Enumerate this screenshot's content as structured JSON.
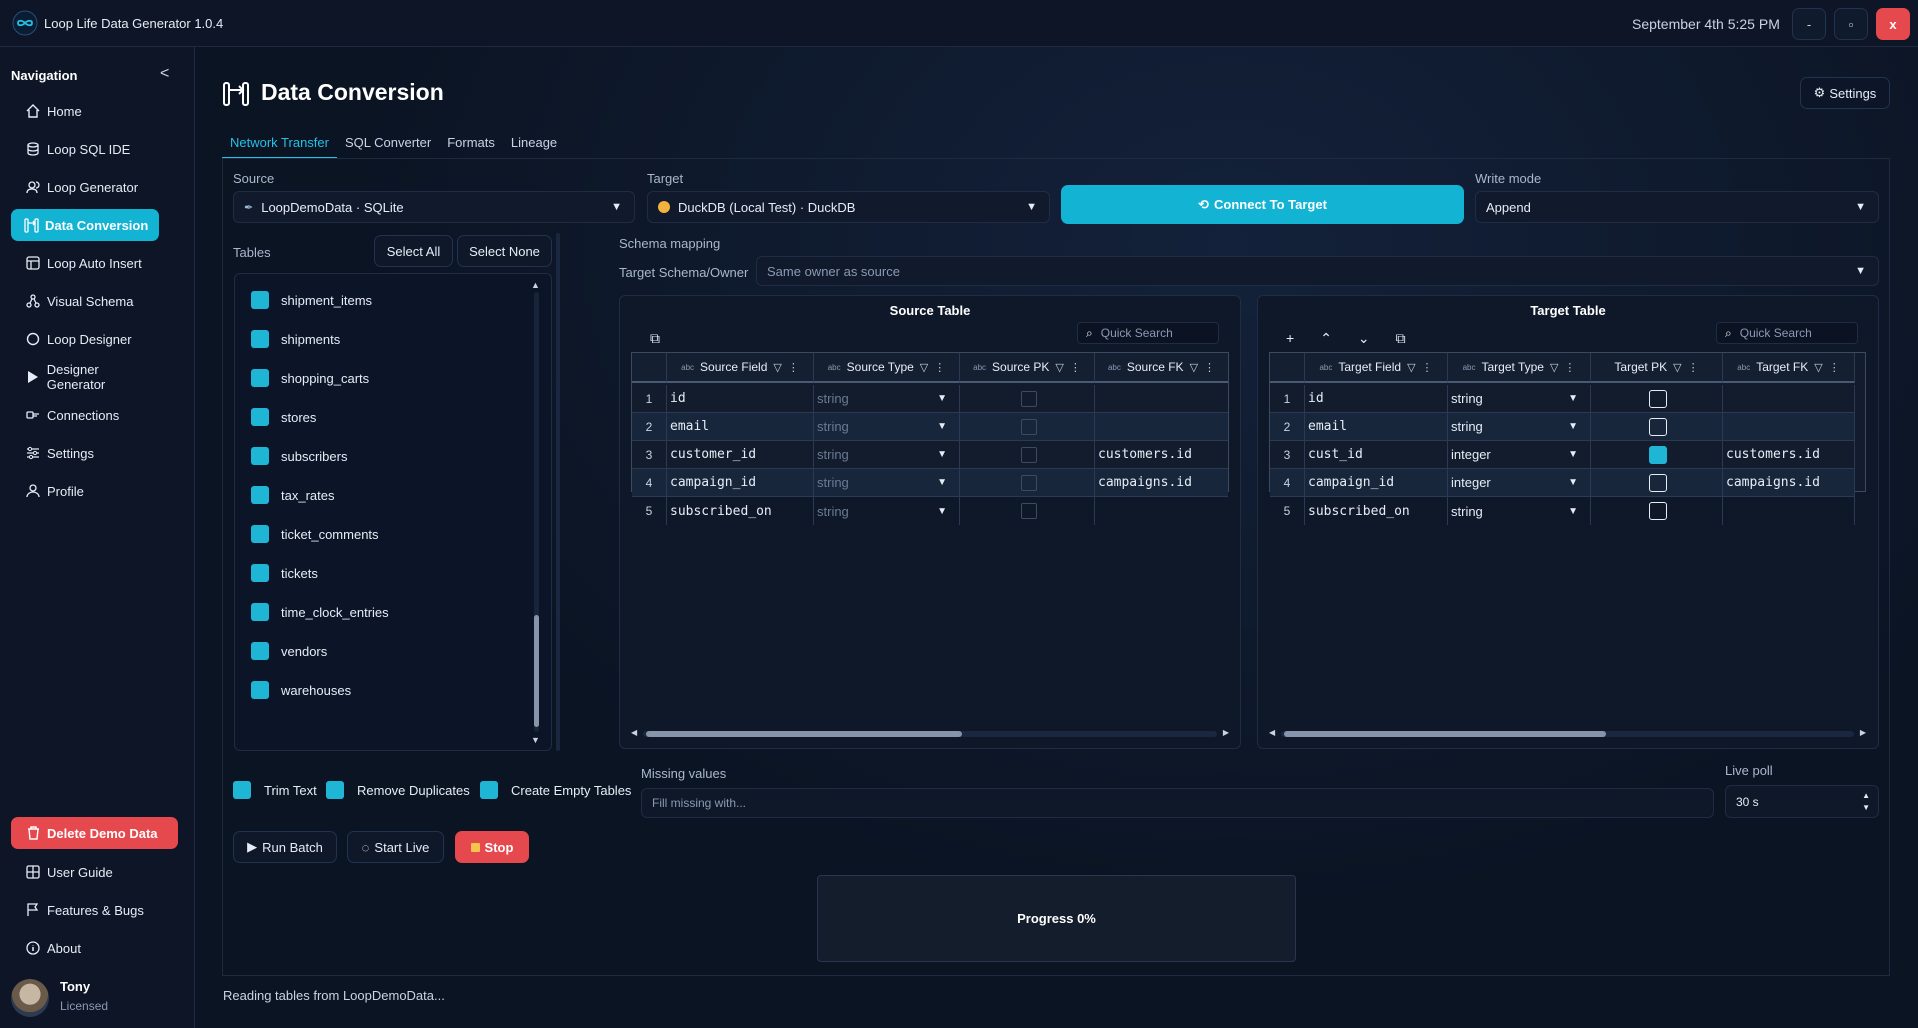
{
  "window": {
    "title": "Loop Life Data Generator 1.0.4",
    "datetime": "September 4th 5:25 PM",
    "min_label": "-",
    "max_label": "▫",
    "close_label": "x"
  },
  "sidebar": {
    "title": "Navigation",
    "collapse_label": "<",
    "items": [
      {
        "label": "Home",
        "icon": "home-icon"
      },
      {
        "label": "Loop SQL IDE",
        "icon": "database-icon"
      },
      {
        "label": "Loop Generator",
        "icon": "users-icon"
      },
      {
        "label": "Data Conversion",
        "icon": "conversion-icon",
        "active": true
      },
      {
        "label": "Loop Auto Insert",
        "icon": "table-icon"
      },
      {
        "label": "Visual Schema",
        "icon": "schema-icon"
      },
      {
        "label": "Loop Designer",
        "icon": "circle-icon"
      },
      {
        "label": "Designer Generator",
        "icon": "play-icon"
      },
      {
        "label": "Connections",
        "icon": "plug-icon"
      },
      {
        "label": "Settings",
        "icon": "sliders-icon"
      },
      {
        "label": "Profile",
        "icon": "user-icon"
      }
    ],
    "delete_demo": "Delete Demo Data",
    "bottom_items": [
      {
        "label": "User Guide",
        "icon": "book-icon"
      },
      {
        "label": "Features & Bugs",
        "icon": "flag-icon"
      },
      {
        "label": "About",
        "icon": "info-icon"
      }
    ],
    "user": {
      "name": "Tony",
      "status": "Licensed"
    }
  },
  "page": {
    "title": "Data Conversion",
    "settings_label": "Settings",
    "tabs": [
      "Network Transfer",
      "SQL Converter",
      "Formats",
      "Lineage"
    ]
  },
  "form": {
    "source_label": "Source",
    "source_value": "LoopDemoData · SQLite",
    "target_label": "Target",
    "target_value": "DuckDB (Local Test) · DuckDB",
    "connect_label": "Connect To Target",
    "write_mode_label": "Write mode",
    "write_mode_value": "Append",
    "tables_label": "Tables",
    "select_all": "Select All",
    "select_none": "Select None",
    "schema_mapping_label": "Schema mapping",
    "target_schema_label": "Target Schema/Owner",
    "target_schema_placeholder": "Same owner as source"
  },
  "tables": [
    "shipment_items",
    "shipments",
    "shopping_carts",
    "stores",
    "subscribers",
    "tax_rates",
    "ticket_comments",
    "tickets",
    "time_clock_entries",
    "vendors",
    "warehouses"
  ],
  "source_grid": {
    "title": "Source Table",
    "search_placeholder": "Quick Search",
    "columns": [
      "Source Field",
      "Source Type",
      "Source PK",
      "Source FK"
    ],
    "type_tag": "abc",
    "rows": [
      {
        "n": "1",
        "field": "id",
        "type": "string",
        "fk": ""
      },
      {
        "n": "2",
        "field": "email",
        "type": "string",
        "fk": ""
      },
      {
        "n": "3",
        "field": "customer_id",
        "type": "string",
        "fk": "customers.id"
      },
      {
        "n": "4",
        "field": "campaign_id",
        "type": "string",
        "fk": "campaigns.id"
      },
      {
        "n": "5",
        "field": "subscribed_on",
        "type": "string",
        "fk": ""
      }
    ]
  },
  "target_grid": {
    "title": "Target Table",
    "search_placeholder": "Quick Search",
    "columns": [
      "Target Field",
      "Target Type",
      "Target PK",
      "Target FK"
    ],
    "type_tag": "abc",
    "rows": [
      {
        "n": "1",
        "field": "id",
        "type": "string",
        "pk": false,
        "fk": ""
      },
      {
        "n": "2",
        "field": "email",
        "type": "string",
        "pk": false,
        "fk": ""
      },
      {
        "n": "3",
        "field": "cust_id",
        "type": "integer",
        "pk": true,
        "fk": "customers.id"
      },
      {
        "n": "4",
        "field": "campaign_id",
        "type": "integer",
        "pk": false,
        "fk": "campaigns.id"
      },
      {
        "n": "5",
        "field": "subscribed_on",
        "type": "string",
        "pk": false,
        "fk": ""
      }
    ]
  },
  "options": {
    "trim_text": "Trim Text",
    "remove_duplicates": "Remove Duplicates",
    "create_empty_tables": "Create Empty Tables",
    "missing_values_label": "Missing values",
    "missing_values_placeholder": "Fill missing with...",
    "live_poll_label": "Live poll",
    "live_poll_value": "30 s"
  },
  "actions": {
    "run_batch": "Run Batch",
    "start_live": "Start Live",
    "stop": "Stop"
  },
  "progress": {
    "label": "Progress 0%",
    "value": 0
  },
  "status": "Reading tables from LoopDemoData...",
  "colors": {
    "accent": "#13b3d4",
    "danger": "#e5484d",
    "background": "#0b1220"
  }
}
